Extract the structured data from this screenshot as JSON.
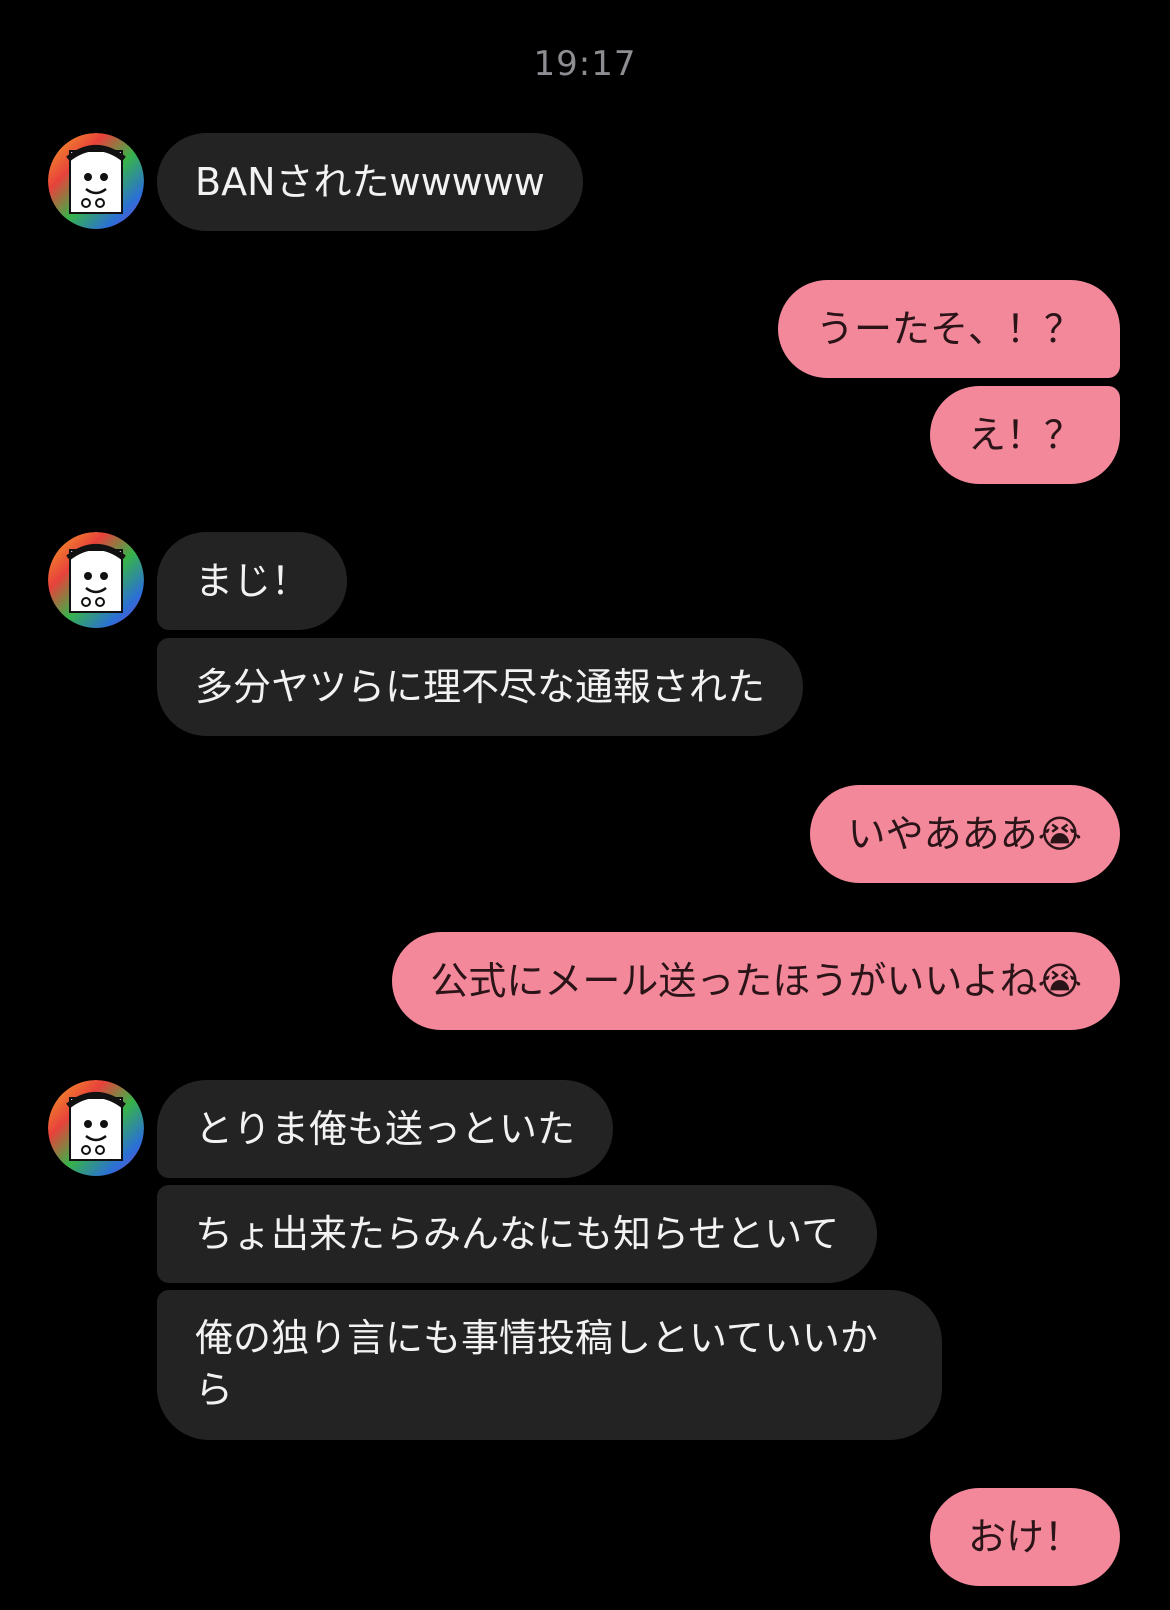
{
  "chat": {
    "timestamp": "19:17",
    "messages": [
      {
        "from": "other",
        "text": "BANされたwwwww"
      },
      {
        "from": "me",
        "text": "うーたそ、！？"
      },
      {
        "from": "me",
        "text": "え！？"
      },
      {
        "from": "other",
        "text": "まじ！"
      },
      {
        "from": "other",
        "text": "多分ヤツらに理不尽な通報された"
      },
      {
        "from": "me",
        "text": "いやあああ😭"
      },
      {
        "from": "me",
        "text": "公式にメール送ったほうがいいよね😭"
      },
      {
        "from": "other",
        "text": "とりま俺も送っといた"
      },
      {
        "from": "other",
        "text": "ちょ出来たらみんなにも知らせといて"
      },
      {
        "from": "other",
        "text": "俺の独り言にも事情投稿しといていいから"
      },
      {
        "from": "me",
        "text": "おけ！"
      }
    ]
  },
  "colors": {
    "background": "#000000",
    "incoming_bubble": "#232323",
    "outgoing_bubble": "#f2889a",
    "timestamp": "#8d8d92"
  },
  "icons": {
    "avatar": "cartoon-face-avatar-icon"
  }
}
